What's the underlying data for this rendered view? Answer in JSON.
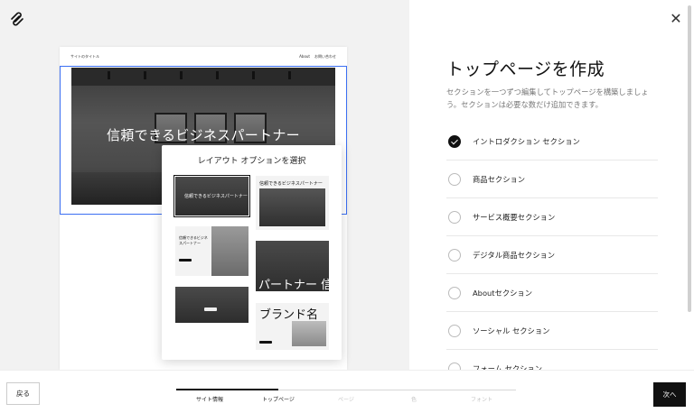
{
  "preview": {
    "site_name": "サイトのタイトル",
    "nav_links": [
      "About",
      "お問い合わせ"
    ],
    "hero_title": "信頼できるビジネスパートナー"
  },
  "layout_popup": {
    "title": "レイアウト オプションを選択",
    "thumb_texts": {
      "t1": "信頼できるビジネスパートナー",
      "t2": "信頼できるビジネスパートナー",
      "t3_line1": "信頼できるビジネ",
      "t3_line2": "スパートナー",
      "t6": "パートナー 信",
      "t7": "ブランド名"
    }
  },
  "panel": {
    "title": "トップページを作成",
    "description": "セクションを一つずつ編集してトップページを構築しましょう。セクションは必要な数だけ追加できます。",
    "sections": [
      {
        "label": "イントロダクション セクション",
        "checked": true
      },
      {
        "label": "商品セクション",
        "checked": false
      },
      {
        "label": "サービス概要セクション",
        "checked": false
      },
      {
        "label": "デジタル商品セクション",
        "checked": false
      },
      {
        "label": "Aboutセクション",
        "checked": false
      },
      {
        "label": "ソーシャル セクション",
        "checked": false
      },
      {
        "label": "フォーム セクション",
        "checked": false
      }
    ]
  },
  "footer": {
    "back_label": "戻る",
    "next_label": "次へ",
    "steps": [
      {
        "label": "サイト情報",
        "state": "done"
      },
      {
        "label": "トップページ",
        "state": "current"
      },
      {
        "label": "ページ",
        "state": "upcoming"
      },
      {
        "label": "色",
        "state": "upcoming"
      },
      {
        "label": "フォント",
        "state": "upcoming"
      }
    ],
    "progress": 0.3
  },
  "colors": {
    "accent": "#3b6ff2",
    "primary_button": "#111111",
    "muted_text": "#777777",
    "left_background": "#f2f2f2"
  },
  "icons": {
    "logo": "squarespace-logo-icon",
    "close": "close-icon",
    "check": "check-circle-icon"
  }
}
